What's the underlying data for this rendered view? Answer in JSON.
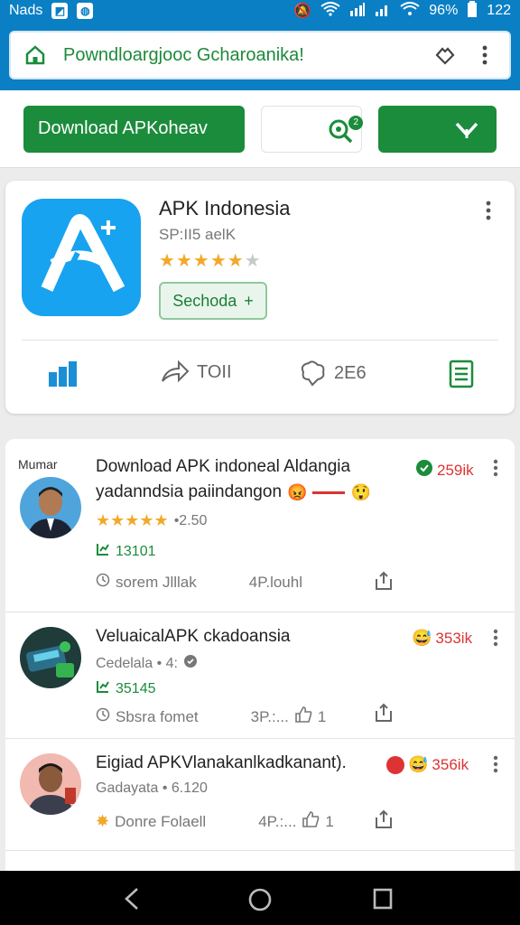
{
  "status": {
    "left_text": "Nads",
    "battery": "96%",
    "time": "122"
  },
  "urlbar": {
    "url": "Powndloargjooc Gcharoanika!"
  },
  "toolbar": {
    "download_label": "Download APKoheav",
    "notif_count": "2"
  },
  "app": {
    "title": "APK Indonesia",
    "subtitle": "SP:II5 aelK",
    "rating": 4.5,
    "install_label": "Sechoda",
    "install_symbol": "+",
    "actions": {
      "share_label": "TOII",
      "react_count": "2E6"
    }
  },
  "feed": {
    "header": "Mumar",
    "items": [
      {
        "title_line1": "Download APK indoneal Aldangia",
        "title_line2": "yadanndsia paiindangon",
        "count": "259ik",
        "rating_text": "•2.50",
        "stat": "13101",
        "footer_left": "sorem Jlllak",
        "footer_mid": "4P.louhl"
      },
      {
        "title_line1": "VeluaicalAPK ckadoansia",
        "count": "353ik",
        "meta": "Cedelala • 4:",
        "stat": "35145",
        "footer_left": "Sbsra fomet",
        "footer_mid": "3P.:...",
        "footer_num": "1"
      },
      {
        "title_line1": "Eigiad APKVlanakanlkadkanant).",
        "count": "356ik",
        "meta": "Gadayata • 6.120",
        "footer_left": "Donre Folaell",
        "footer_mid": "4P.:...",
        "footer_num": "1"
      }
    ]
  },
  "colors": {
    "primary_blue": "#0a7fc4",
    "green": "#1b8c3b",
    "red": "#d33333",
    "star": "#f2a92a"
  }
}
